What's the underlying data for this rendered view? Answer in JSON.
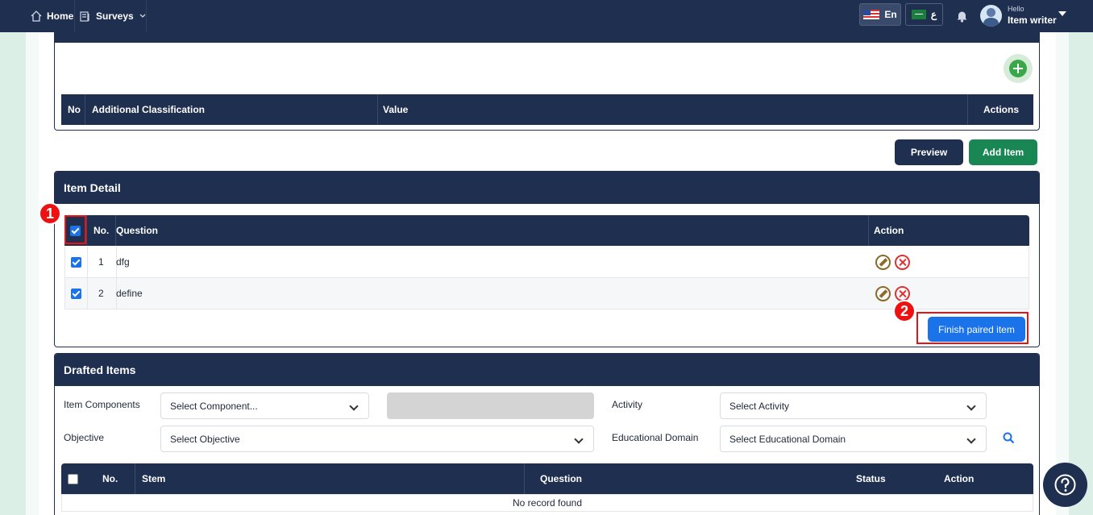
{
  "nav": {
    "home_label": "Home",
    "surveys_label": "Surveys",
    "lang_en": "En",
    "lang_ar": "ع",
    "greeting": "Hello",
    "user_name": "Item writer"
  },
  "classification": {
    "columns": [
      "No",
      "Additional Classification",
      "Value",
      "Actions"
    ]
  },
  "buttons": {
    "preview": "Preview",
    "add_item": "Add Item",
    "finish_paired": "Finish paired item"
  },
  "item_detail": {
    "title": "Item Detail",
    "columns": {
      "no": "No.",
      "question": "Question",
      "action": "Action"
    },
    "rows": [
      {
        "no": "1",
        "question": "dfg",
        "checked": true
      },
      {
        "no": "2",
        "question": "define",
        "checked": true
      }
    ]
  },
  "drafted": {
    "title": "Drafted Items",
    "filters": {
      "item_components_label": "Item Components",
      "item_components_value": "Select Component...",
      "activity_label": "Activity",
      "activity_value": "Select Activity",
      "objective_label": "Objective",
      "objective_value": "Select Objective",
      "domain_label": "Educational Domain",
      "domain_value": "Select Educational Domain"
    },
    "columns": {
      "no": "No.",
      "stem": "Stem",
      "question": "Question",
      "status": "Status",
      "action": "Action"
    },
    "empty_message": "No record found"
  },
  "annotations": {
    "badge1": "1",
    "badge2": "2"
  },
  "colors": {
    "navy": "#1f2f4f",
    "green": "#198754",
    "blue": "#1a73e8",
    "annotation_red": "#e11111"
  }
}
